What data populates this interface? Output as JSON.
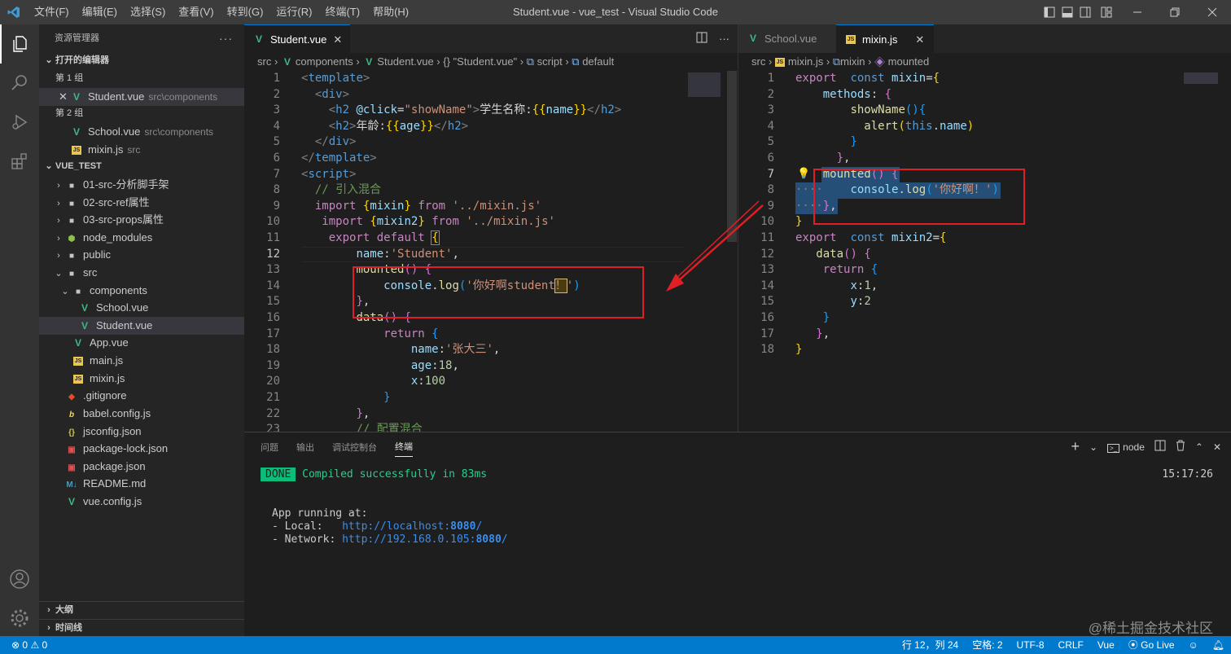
{
  "titlebar": {
    "menu": [
      "文件(F)",
      "编辑(E)",
      "选择(S)",
      "查看(V)",
      "转到(G)",
      "运行(R)",
      "终端(T)",
      "帮助(H)"
    ],
    "title": "Student.vue - vue_test - Visual Studio Code"
  },
  "sidebar": {
    "title": "资源管理器",
    "open_editors": "打开的编辑器",
    "group1": "第 1 组",
    "group2": "第 2 组",
    "open1": {
      "name": "Student.vue",
      "desc": "src\\components"
    },
    "open2": {
      "name": "School.vue",
      "desc": "src\\components"
    },
    "open3": {
      "name": "mixin.js",
      "desc": "src"
    },
    "project": "VUE_TEST",
    "tree": [
      "01-src-分析脚手架",
      "02-src-ref属性",
      "03-src-props属性",
      "node_modules",
      "public",
      "src",
      "components",
      "School.vue",
      "Student.vue",
      "App.vue",
      "main.js",
      "mixin.js",
      ".gitignore",
      "babel.config.js",
      "jsconfig.json",
      "package-lock.json",
      "package.json",
      "README.md",
      "vue.config.js"
    ],
    "outline": "大纲",
    "timeline": "时间线"
  },
  "editor1": {
    "tab": "Student.vue",
    "crumbs": [
      "src",
      "components",
      "Student.vue",
      "{} \"Student.vue\"",
      "script",
      "default"
    ],
    "lines": [
      "1",
      "2",
      "3",
      "4",
      "5",
      "6",
      "7",
      "8",
      "9",
      "10",
      "11",
      "12",
      "13",
      "14",
      "15",
      "16",
      "17",
      "18",
      "19",
      "20",
      "21",
      "22",
      "23"
    ]
  },
  "editor2": {
    "tab_inactive": "School.vue",
    "tab_active": "mixin.js",
    "crumbs": [
      "src",
      "mixin.js",
      "mixin",
      "mounted"
    ],
    "lines": [
      "1",
      "2",
      "3",
      "4",
      "5",
      "6",
      "7",
      "8",
      "9",
      "10",
      "11",
      "12",
      "13",
      "14",
      "15",
      "16",
      "17",
      "18"
    ]
  },
  "panel": {
    "tabs": [
      "问题",
      "输出",
      "调试控制台",
      "终端"
    ],
    "shell": "node",
    "done": "DONE",
    "compiled": "Compiled successfully in 83ms",
    "time": "15:17:26",
    "running": "App running at:",
    "local_label": "- Local:   ",
    "local_url": "http://localhost:",
    "local_port": "8080",
    "network_label": "- Network: ",
    "network_url": "http://192.168.0.105:",
    "network_port": "8080",
    "slash": "/"
  },
  "statusbar": {
    "errors": "0",
    "warnings": "0",
    "position": "行 12，列 24",
    "spaces": "空格: 2",
    "encoding": "UTF-8",
    "eol": "CRLF",
    "lang": "Vue",
    "golive": "Go Live"
  },
  "watermark": "@稀土掘金技术社区",
  "colors": {
    "accent": "#007acc",
    "highlight_box": "#e01e25"
  }
}
